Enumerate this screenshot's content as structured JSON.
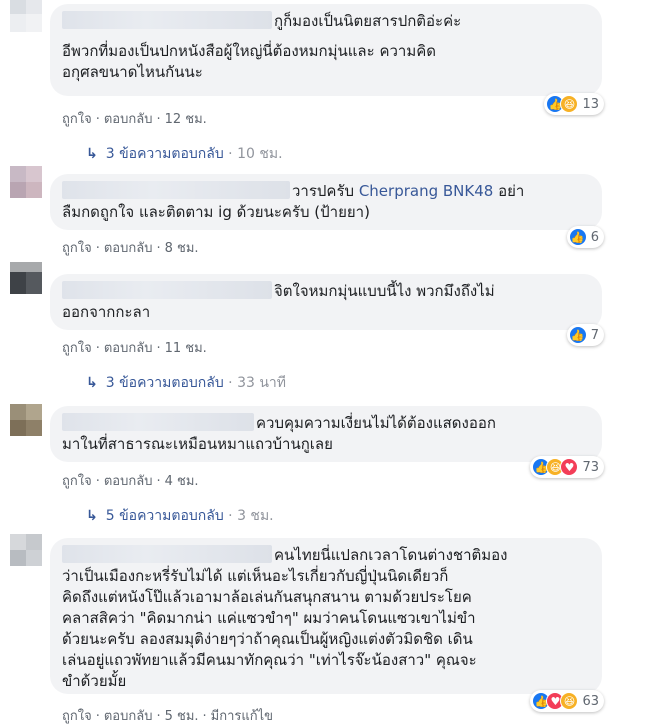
{
  "comments": [
    {
      "text_lines": [
        "กูก็มองเป็นนิตยสารปกติอ่ะค่ะ",
        "อีพวกที่มองเป็นปกหนังสือผู้ใหญ่นี่ต้องหมกมุ่นและ ความคิด",
        "อกุศลขนาดไหนกันนะ"
      ],
      "like_label": "ถูกใจ",
      "reply_label": "ตอบกลับ",
      "time": "12 ชม.",
      "reaction_icons": [
        "like-reaction",
        "haha-reaction"
      ],
      "reaction_count": "13",
      "replies_label": "3 ข้อความตอบกลับ",
      "replies_time": "10 ชม."
    },
    {
      "text_prefix": "วารปครับ ",
      "text_link": "Cherprang BNK48",
      "text_suffix": " อย่า",
      "text_lines": [
        "ลืมกดถูกใจ และติดตาม ig ด้วยนะครับ (ป้ายยา)"
      ],
      "like_label": "ถูกใจ",
      "reply_label": "ตอบกลับ",
      "time": "8 ชม.",
      "reaction_icons": [
        "like-reaction"
      ],
      "reaction_count": "6"
    },
    {
      "text_lines": [
        "จิตใจหมกมุ่นแบบนี้ไง พวกมึงถึงไม่",
        "ออกจากกะลา"
      ],
      "like_label": "ถูกใจ",
      "reply_label": "ตอบกลับ",
      "time": "11 ชม.",
      "reaction_icons": [
        "like-reaction"
      ],
      "reaction_count": "7",
      "replies_label": "3 ข้อความตอบกลับ",
      "replies_time": "33 นาที"
    },
    {
      "text_lines": [
        "ควบคุมความเงี่ยนไม่ได้ต้องแสดงออก",
        "มาในที่สาธารณะเหมือนหมาแถวบ้านกูเลย"
      ],
      "like_label": "ถูกใจ",
      "reply_label": "ตอบกลับ",
      "time": "4 ชม.",
      "reaction_icons": [
        "like-reaction",
        "haha-reaction",
        "love-reaction"
      ],
      "reaction_count": "73",
      "replies_label": "5 ข้อความตอบกลับ",
      "replies_time": "3 ชม."
    },
    {
      "text_lines": [
        "คนไทยนี่แปลกเวลาโดนต่างชาติมอง",
        "ว่าเป็นเมืองกะหรี่รับไม่ได้ แต่เห็นอะไรเกี่ยวกับญี่ปุ่นนิดเดียวก็",
        "คิดถึงแต่หนังโป๊แล้วเอามาล้อเล่นกันสนุกสนาน ตามด้วยประโยค",
        "คลาสสิคว่า \"คิดมากน่า แค่แซวขำๆ\" ผมว่าคนโดนแซวเขาไม่ขำ",
        "ด้วยนะครับ ลองสมมุติง่ายๆว่าถ้าคุณเป็นผู้หญิงแต่งตัวมิดชิด เดิน",
        "เล่นอยู่แถวพัทยาแล้วมีคนมาทักคุณว่า \"เท่าไรจ๊ะน้องสาว\" คุณจะ",
        "ขำด้วยมั้ย"
      ],
      "like_label": "ถูกใจ",
      "reply_label": "ตอบกลับ",
      "time": "5 ชม.",
      "edited_label": "มีการแก้ไข",
      "reaction_icons": [
        "like-reaction",
        "love-reaction",
        "haha-reaction"
      ],
      "reaction_count": "63"
    }
  ]
}
